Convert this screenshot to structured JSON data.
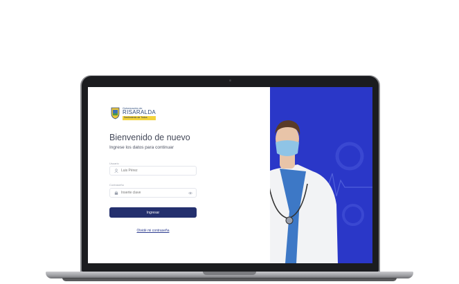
{
  "logo": {
    "small_text": "Gobernación de",
    "big_text": "RISARALDA",
    "tagline": "Sentimiento de Todos"
  },
  "login": {
    "title": "Bienvenido de nuevo",
    "subtitle": "Ingrese los datos para continuar",
    "user_label": "Usuario",
    "user_placeholder": "Luis Pérez",
    "password_label": "Contraseña",
    "password_placeholder": "Inserte clave",
    "submit_label": "Ingresar",
    "forgot_label": "Olvidé mi contraseña"
  },
  "colors": {
    "accent": "#24306e",
    "panel": "#2a37c8",
    "link": "#2a3a8e"
  },
  "icons": {
    "user_field": "user-icon",
    "password_field": "lock-icon",
    "toggle": "eye-icon",
    "logo": "shield-icon"
  }
}
